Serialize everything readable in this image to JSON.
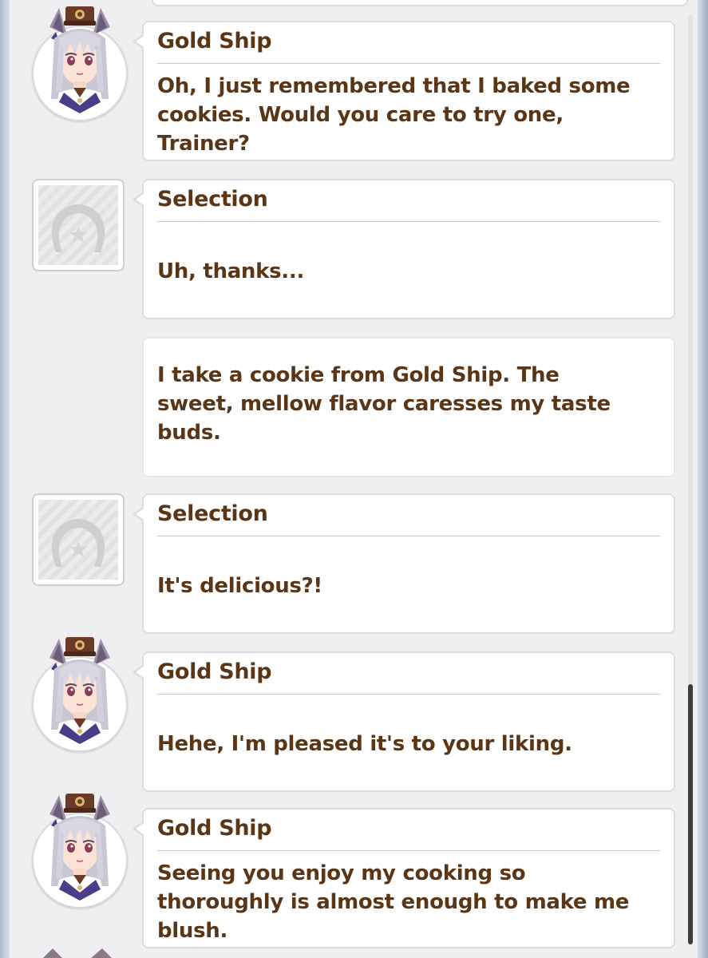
{
  "dialogue": [
    {
      "speaker": "Gold Ship",
      "text": "Oh, I just remembered that I baked some\ncookies. Would you care to try one,\nTrainer?",
      "avatar": "gold-ship-portrait"
    },
    {
      "speaker": "Selection",
      "text": "Uh, thanks...",
      "avatar": "trainer-horseshoe-placeholder"
    },
    {
      "speaker": "",
      "text": "I take a cookie from Gold Ship. The\nsweet, mellow flavor caresses my taste\nbuds.",
      "avatar": ""
    },
    {
      "speaker": "Selection",
      "text": "It's delicious?!",
      "avatar": "trainer-horseshoe-placeholder"
    },
    {
      "speaker": "Gold Ship",
      "text": "Hehe, I'm pleased it's to your liking.",
      "avatar": "gold-ship-portrait"
    },
    {
      "speaker": "Gold Ship",
      "text": "Seeing you enjoy my cooking so\nthoroughly is almost enough to make me\nblush.",
      "avatar": "gold-ship-portrait"
    }
  ],
  "colors": {
    "text": "#5b3616",
    "bubble": "#ffffff",
    "bubble_border": "#dcdce0",
    "panel": "#efeff1",
    "scroll_thumb": "#3c3c3c"
  },
  "scroll": {
    "position_fraction": 0.72,
    "visible_fraction": 0.28
  }
}
